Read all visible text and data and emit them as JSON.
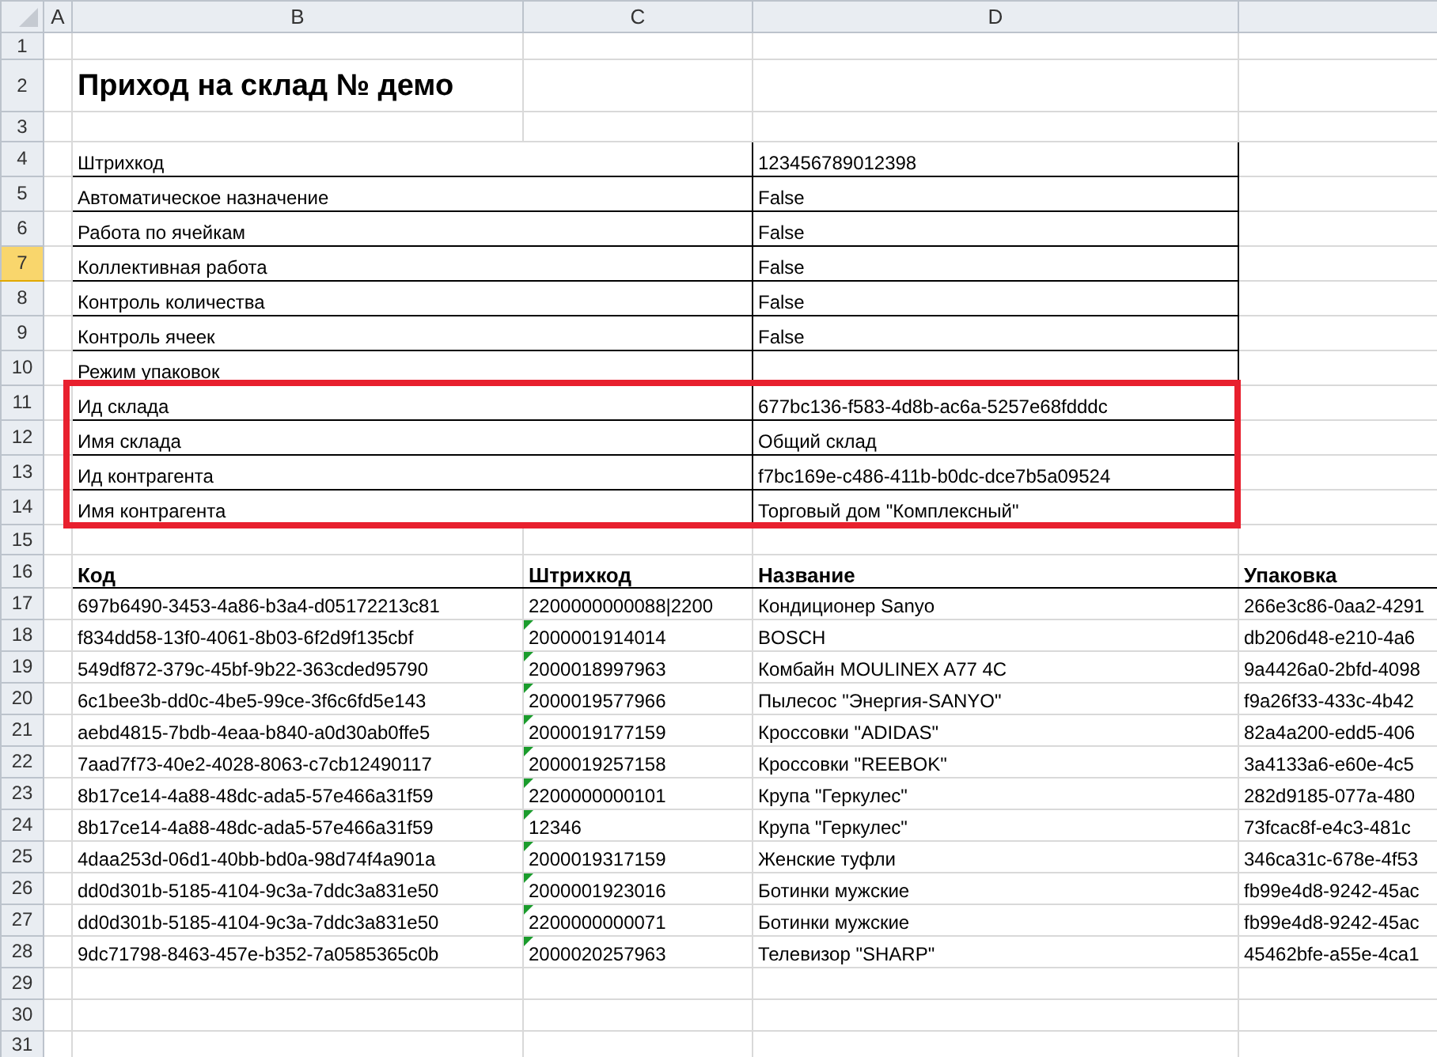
{
  "column_headers": [
    "A",
    "B",
    "C",
    "D"
  ],
  "row_headers": [
    {
      "label": "1",
      "selected": false
    },
    {
      "label": "2",
      "selected": false
    },
    {
      "label": "3",
      "selected": false
    },
    {
      "label": "4",
      "selected": false
    },
    {
      "label": "5",
      "selected": false
    },
    {
      "label": "6",
      "selected": false
    },
    {
      "label": "7",
      "selected": true
    },
    {
      "label": "8",
      "selected": false
    },
    {
      "label": "9",
      "selected": false
    },
    {
      "label": "10",
      "selected": false
    },
    {
      "label": "11",
      "selected": false
    },
    {
      "label": "12",
      "selected": false
    },
    {
      "label": "13",
      "selected": false
    },
    {
      "label": "14",
      "selected": false
    },
    {
      "label": "15",
      "selected": false
    },
    {
      "label": "16",
      "selected": false
    },
    {
      "label": "17",
      "selected": false
    },
    {
      "label": "18",
      "selected": false
    },
    {
      "label": "19",
      "selected": false
    },
    {
      "label": "20",
      "selected": false
    },
    {
      "label": "21",
      "selected": false
    },
    {
      "label": "22",
      "selected": false
    },
    {
      "label": "23",
      "selected": false
    },
    {
      "label": "24",
      "selected": false
    },
    {
      "label": "25",
      "selected": false
    },
    {
      "label": "26",
      "selected": false
    },
    {
      "label": "27",
      "selected": false
    },
    {
      "label": "28",
      "selected": false
    },
    {
      "label": "29",
      "selected": false
    },
    {
      "label": "30",
      "selected": false
    },
    {
      "label": "31",
      "selected": false
    }
  ],
  "title": "Приход на склад № демо",
  "properties": [
    {
      "label": "Штрихкод",
      "value": "123456789012398",
      "highlighted": false
    },
    {
      "label": "Автоматическое назначение",
      "value": "False",
      "highlighted": false
    },
    {
      "label": "Работа по ячейкам",
      "value": "False",
      "highlighted": false
    },
    {
      "label": "Коллективная работа",
      "value": "False",
      "highlighted": false
    },
    {
      "label": "Контроль количества",
      "value": "False",
      "highlighted": false
    },
    {
      "label": "Контроль ячеек",
      "value": "False",
      "highlighted": false
    },
    {
      "label": "Режим упаковок",
      "highlighted": false
    },
    {
      "label": "Ид склада",
      "value": "677bc136-f583-4d8b-ac6a-5257e68fdddc",
      "highlighted": true
    },
    {
      "label": "Имя склада",
      "value": "Общий склад",
      "highlighted": true
    },
    {
      "label": "Ид контрагента",
      "value": "f7bc169e-c486-411b-b0dc-dce7b5a09524",
      "highlighted": true
    },
    {
      "label": "Имя контрагента",
      "value": "Торговый дом \"Комплексный\"",
      "highlighted": true
    }
  ],
  "items": {
    "columns": [
      "Код",
      "Штрихкод",
      "Название",
      "Упаковка"
    ],
    "rows": [
      {
        "code": "697b6490-3453-4a86-b3a4-d05172213c81",
        "barcode": "2200000000088|2200",
        "name": "Кондиционер Sanyo",
        "pack": "266e3c86-0aa2-4291",
        "number_as_text": false
      },
      {
        "code": "f834dd58-13f0-4061-8b03-6f2d9f135cbf",
        "barcode": "2000001914014",
        "name": "BOSCH",
        "pack": "db206d48-e210-4a6",
        "number_as_text": true
      },
      {
        "code": "549df872-379c-45bf-9b22-363cded95790",
        "barcode": "2000018997963",
        "name": "Комбайн MOULINEX  A77 4C",
        "pack": "9a4426a0-2bfd-4098",
        "number_as_text": true
      },
      {
        "code": "6c1bee3b-dd0c-4be5-99ce-3f6c6fd5e143",
        "barcode": "2000019577966",
        "name": "Пылесос \"Энергия-SANYO\"",
        "pack": "f9a26f33-433c-4b42",
        "number_as_text": true
      },
      {
        "code": "aebd4815-7bdb-4eaa-b840-a0d30ab0ffe5",
        "barcode": "2000019177159",
        "name": "Кроссовки \"ADIDAS\"",
        "pack": "82a4a200-edd5-406",
        "number_as_text": true
      },
      {
        "code": "7aad7f73-40e2-4028-8063-c7cb12490117",
        "barcode": "2000019257158",
        "name": "Кроссовки \"REEBOK\"",
        "pack": "3a4133a6-e60e-4c5",
        "number_as_text": true
      },
      {
        "code": "8b17ce14-4a88-48dc-ada5-57e466a31f59",
        "barcode": "2200000000101",
        "name": "Крупа \"Геркулес\"",
        "pack": "282d9185-077a-480",
        "number_as_text": true
      },
      {
        "code": "8b17ce14-4a88-48dc-ada5-57e466a31f59",
        "barcode": "12346",
        "name": "Крупа \"Геркулес\"",
        "pack": "73fcac8f-e4c3-481c",
        "number_as_text": true
      },
      {
        "code": "4daa253d-06d1-40bb-bd0a-98d74f4a901a",
        "barcode": "2000019317159",
        "name": "Женские туфли",
        "pack": "346ca31c-678e-4f53",
        "number_as_text": true
      },
      {
        "code": "dd0d301b-5185-4104-9c3a-7ddc3a831e50",
        "barcode": "2000001923016",
        "name": "Ботинки мужские",
        "pack": "fb99e4d8-9242-45ac",
        "number_as_text": true
      },
      {
        "code": "dd0d301b-5185-4104-9c3a-7ddc3a831e50",
        "barcode": "2200000000071",
        "name": "Ботинки мужские",
        "pack": "fb99e4d8-9242-45ac",
        "number_as_text": true
      },
      {
        "code": "9dc71798-8463-457e-b352-7a0585365c0b",
        "barcode": "2000020257963",
        "name": "Телевизор \"SHARP\"",
        "pack": "45462bfe-a55e-4ca1",
        "number_as_text": true
      }
    ]
  }
}
